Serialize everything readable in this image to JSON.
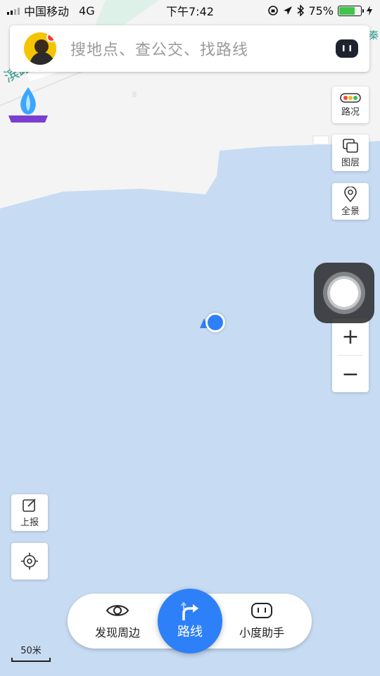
{
  "status_bar": {
    "carrier": "中国移动",
    "network": "4G",
    "time": "下午7:42",
    "battery_percent": "75%",
    "battery_level": 0.75
  },
  "map": {
    "road_label": "滨路",
    "edge_label": "秦",
    "scale_label": "50米",
    "water_color": "#c7dcf3",
    "land_color": "#f4f4f4"
  },
  "search": {
    "placeholder": "搜地点、查公交、找路线"
  },
  "right_controls": {
    "traffic": "路况",
    "layers": "图层",
    "panorama": "全景",
    "zoom_in": "+",
    "zoom_out": "−"
  },
  "left_controls": {
    "report": "上报"
  },
  "bottom_bar": {
    "discover": "发现周边",
    "route": "路线",
    "assistant": "小度助手"
  },
  "colors": {
    "accent": "#2e80f8",
    "battery_green": "#3ec54a"
  }
}
